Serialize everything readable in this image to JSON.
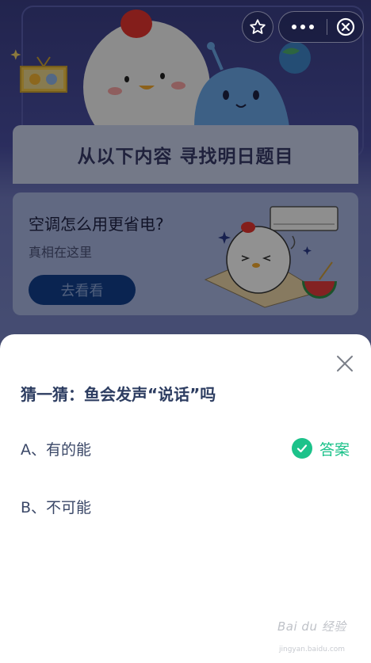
{
  "banner": {
    "header_title": "从以下内容 寻找明日题目"
  },
  "promo": {
    "title": "空调怎么用更省电?",
    "subtitle": "真相在这里",
    "button_label": "去看看"
  },
  "toolbar": {
    "star_icon": "star-outline-icon",
    "more_icon": "more-dots-icon",
    "close_icon": "close-circle-icon"
  },
  "quiz": {
    "question": "猜一猜：鱼会发声“说话”吗",
    "options": [
      {
        "label": "A、有的能",
        "is_answer": true
      },
      {
        "label": "B、不可能",
        "is_answer": false
      }
    ],
    "answer_label": "答案",
    "answer_color": "#1cc28a"
  },
  "watermark": {
    "text": "Bai du 经验",
    "sub": "jingyan.baidu.com"
  }
}
